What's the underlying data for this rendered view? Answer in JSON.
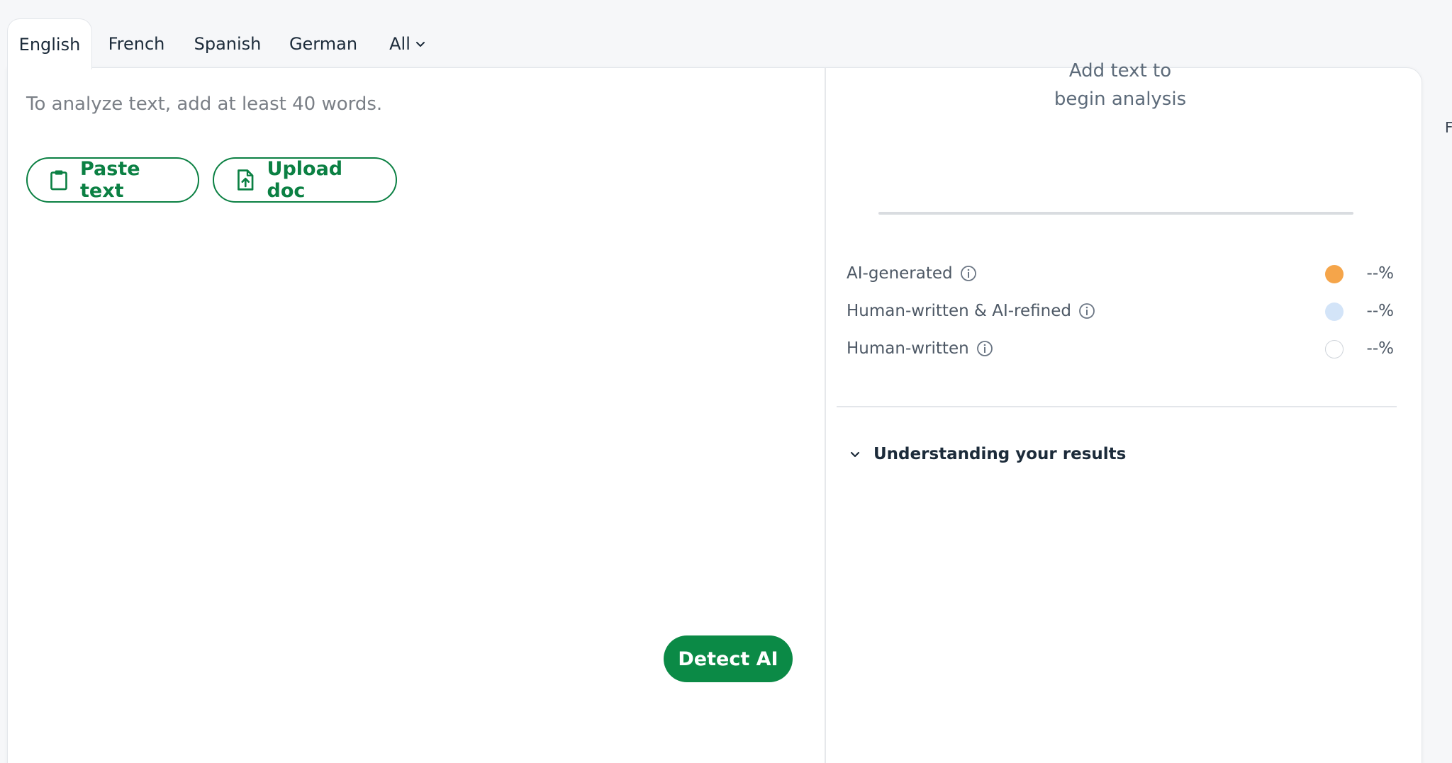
{
  "tabs": [
    {
      "label": "English",
      "active": true
    },
    {
      "label": "French",
      "active": false
    },
    {
      "label": "Spanish",
      "active": false
    },
    {
      "label": "German",
      "active": false
    },
    {
      "label": "All",
      "active": false,
      "icon": "chevron-down-icon"
    }
  ],
  "editor": {
    "placeholder": "To analyze text, add at least 40 words.",
    "paste_label": "Paste text",
    "paste_icon": "clipboard-icon",
    "upload_label": "Upload doc",
    "upload_icon": "file-upload-icon",
    "detect_label": "Detect AI"
  },
  "results": {
    "message_line1": "Add text to",
    "message_line2": "begin analysis",
    "categories": [
      {
        "label": "AI-generated",
        "value": "--%",
        "color": "#f5a54a"
      },
      {
        "label": "Human-written & AI-refined",
        "value": "--%",
        "color": "#d3e4f8"
      },
      {
        "label": "Human-written",
        "value": "--%",
        "color": "#ffffff"
      }
    ],
    "understanding_label": "Understanding your results"
  },
  "colors": {
    "accent": "#0b8043",
    "button_fill": "#0b8a46"
  },
  "edge_text": "F"
}
